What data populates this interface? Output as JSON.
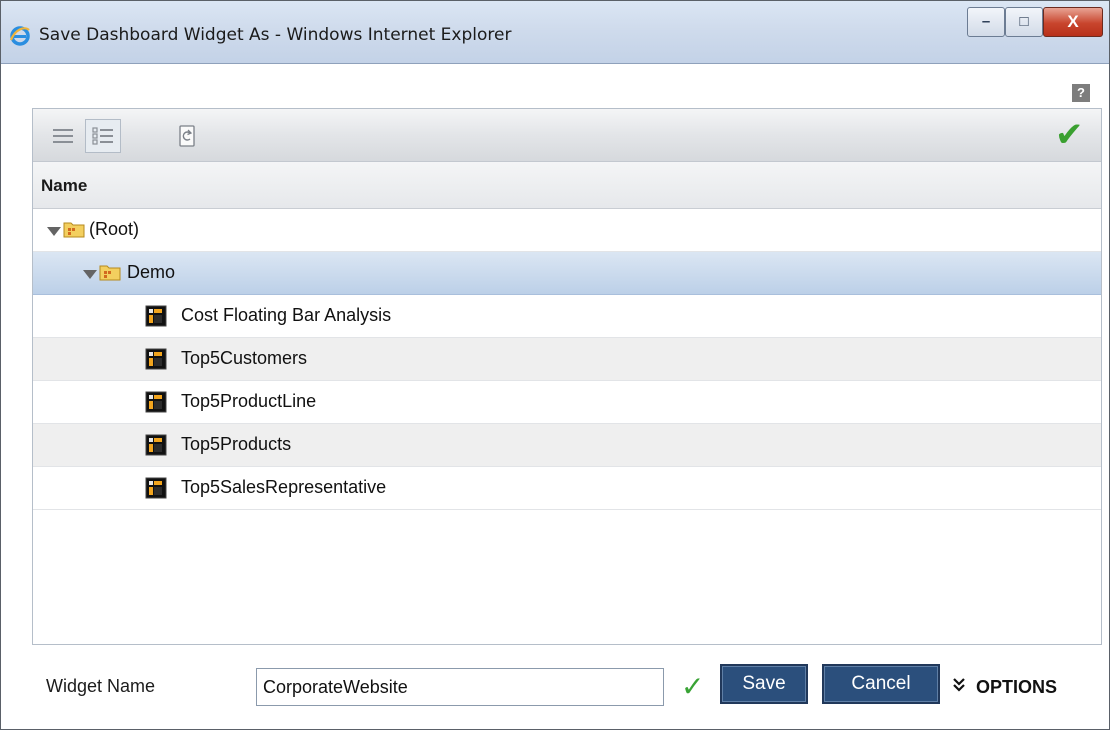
{
  "window": {
    "title": "Save Dashboard Widget As - Windows Internet Explorer",
    "minimize_glyph": "–",
    "maximize_glyph": "□",
    "close_glyph": "X"
  },
  "help": {
    "glyph": "?"
  },
  "toolbar": {
    "icons": [
      "list-view-icon",
      "detail-view-icon",
      "refresh-icon",
      "checkmark-icon"
    ],
    "check_glyph": "✔",
    "accent_color": "#3aa030"
  },
  "tree": {
    "column_header": "Name",
    "root": {
      "label": "(Root)",
      "expanded": true
    },
    "folder": {
      "label": "Demo",
      "expanded": true,
      "selected": true
    },
    "items": [
      {
        "label": "Cost Floating Bar Analysis"
      },
      {
        "label": "Top5Customers"
      },
      {
        "label": "Top5ProductLine"
      },
      {
        "label": "Top5Products"
      },
      {
        "label": "Top5SalesRepresentative"
      }
    ],
    "selection_color": "#bcd0e8"
  },
  "form": {
    "widget_name_label": "Widget Name",
    "widget_name_value": "CorporateWebsite",
    "valid_glyph": "✓",
    "save_label": "Save",
    "cancel_label": "Cancel",
    "options_glyph": "»",
    "options_label": "OPTIONS",
    "button_color": "#2b4f7c"
  }
}
